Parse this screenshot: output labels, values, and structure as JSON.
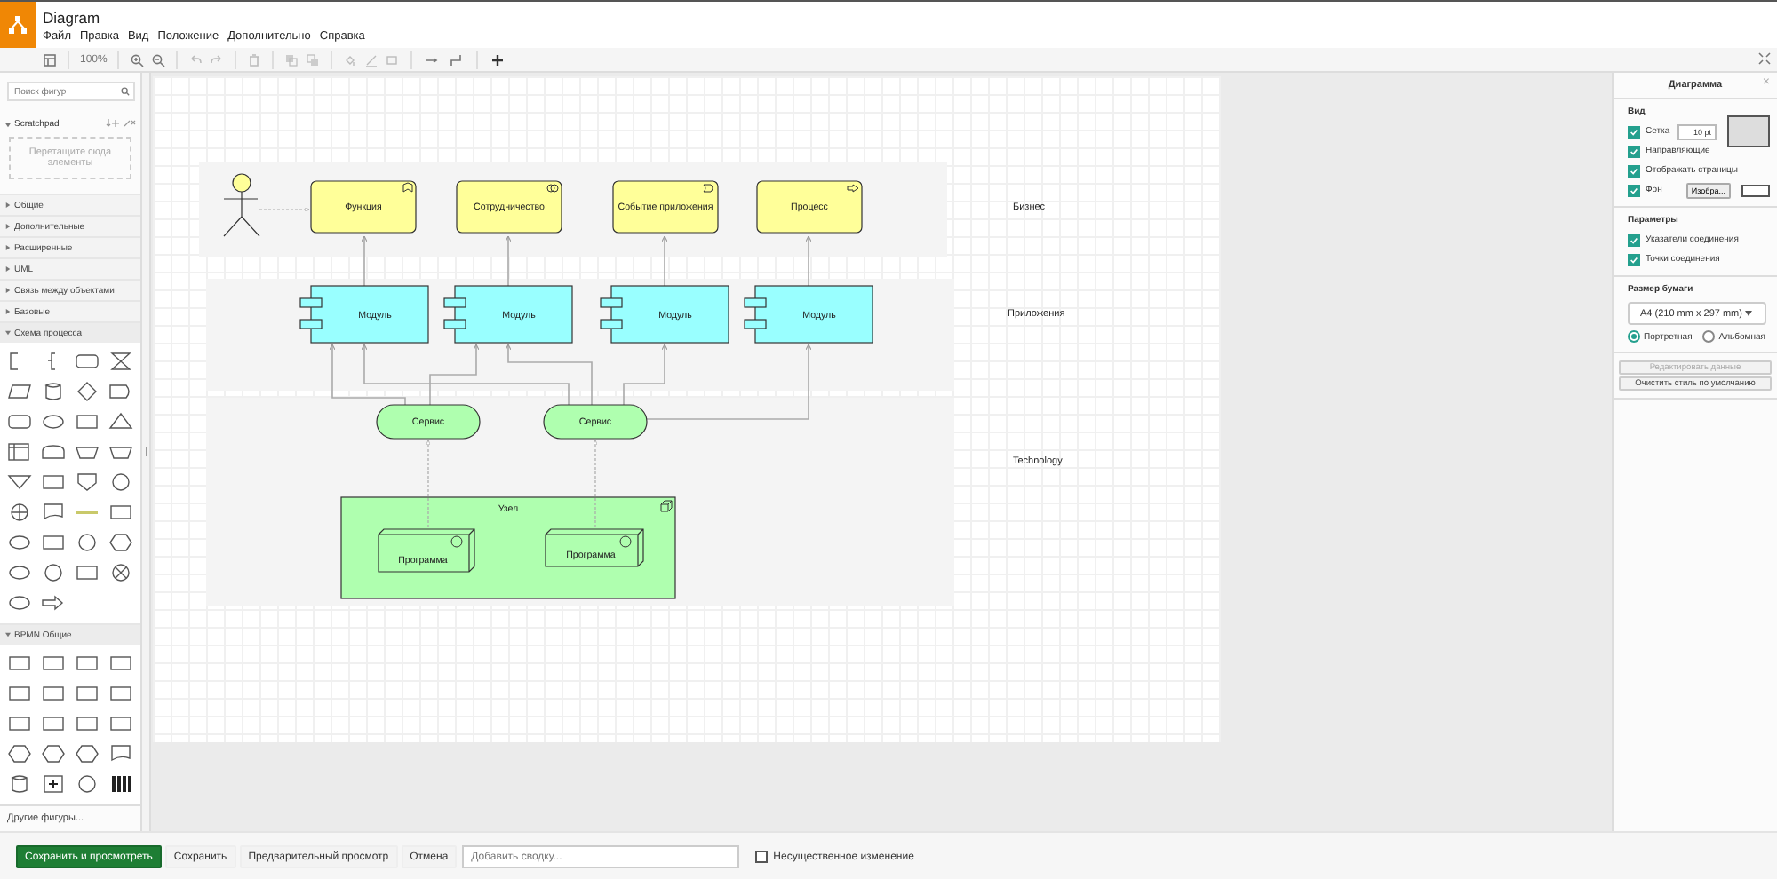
{
  "window": {
    "title": "Diagram"
  },
  "menu": [
    "Файл",
    "Правка",
    "Вид",
    "Положение",
    "Дополнительно",
    "Справка"
  ],
  "toolbar": {
    "zoom": "100%"
  },
  "sidebar": {
    "search": {
      "placeholder": "Поиск фигур"
    },
    "scratchpad": {
      "title": "Scratchpad",
      "hint": "Перетащите сюда элементы",
      "expanded": true
    },
    "categories": [
      {
        "label": "Общие",
        "expanded": false
      },
      {
        "label": "Дополнительные",
        "expanded": false
      },
      {
        "label": "Расширенные",
        "expanded": false
      },
      {
        "label": "UML",
        "expanded": false
      },
      {
        "label": "Связь между объектами",
        "expanded": false
      },
      {
        "label": "Базовые",
        "expanded": false
      },
      {
        "label": "Схема процесса",
        "expanded": true,
        "kind": "flowchart"
      },
      {
        "label": "BPMN Общие",
        "expanded": true,
        "kind": "bpmn"
      }
    ],
    "more": "Другие фигуры..."
  },
  "diagram": {
    "lanes": [
      {
        "label": "Бизнес"
      },
      {
        "label": "Приложения"
      },
      {
        "label": "Technology"
      }
    ],
    "nodes": [
      {
        "kind": "actor"
      },
      {
        "kind": "business",
        "label": "Функция"
      },
      {
        "kind": "business",
        "label": "Сотрудничество"
      },
      {
        "kind": "business",
        "label": "Событие приложения"
      },
      {
        "kind": "business",
        "label": "Процесс"
      },
      {
        "kind": "module",
        "label": "Модуль"
      },
      {
        "kind": "module",
        "label": "Модуль"
      },
      {
        "kind": "module",
        "label": "Модуль"
      },
      {
        "kind": "module",
        "label": "Модуль"
      },
      {
        "kind": "service",
        "label": "Сервис"
      },
      {
        "kind": "service",
        "label": "Сервис"
      },
      {
        "kind": "node",
        "label": "Узел"
      },
      {
        "kind": "program",
        "label": "Программа"
      },
      {
        "kind": "program",
        "label": "Программа"
      }
    ]
  },
  "format_panel": {
    "title": "Диаграмма",
    "close": "×",
    "view": {
      "title": "Вид",
      "options": [
        {
          "label": "Сетка",
          "checked": true,
          "kind": "grid",
          "value": "10 pt"
        },
        {
          "label": "Направляющие",
          "checked": true
        },
        {
          "label": "Отображать страницы",
          "checked": true
        },
        {
          "label": "Фон",
          "checked": true,
          "kind": "background",
          "button": "Изобра..."
        }
      ]
    },
    "options": {
      "title": "Параметры",
      "items": [
        {
          "label": "Указатели соединения",
          "checked": true
        },
        {
          "label": "Точки соединения",
          "checked": true
        }
      ]
    },
    "paper": {
      "title": "Размер бумаги",
      "size": "A4 (210 mm x 297 mm)",
      "orientations": [
        {
          "label": "Портретная",
          "selected": true
        },
        {
          "label": "Альбомная",
          "selected": false
        }
      ]
    },
    "buttons": [
      {
        "label": "Редактировать данные",
        "disabled": true
      },
      {
        "label": "Очистить стиль по умолчанию",
        "disabled": false
      }
    ]
  },
  "footer": {
    "buttons": [
      {
        "label": "Сохранить и просмотреть",
        "kind": "primary"
      },
      {
        "label": "Сохранить",
        "kind": "plain"
      },
      {
        "label": "Предварительный просмотр",
        "kind": "plain"
      },
      {
        "label": "Отмена",
        "kind": "plain"
      }
    ],
    "summary": {
      "placeholder": "Добавить сводку..."
    },
    "minor_edit": {
      "label": "Несущественное изменение",
      "checked": false
    }
  }
}
